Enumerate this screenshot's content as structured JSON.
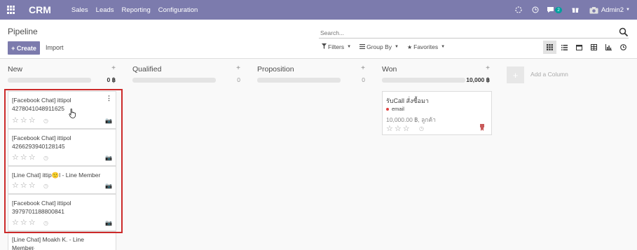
{
  "navbar": {
    "brand": "CRM",
    "menu": [
      "Sales",
      "Leads",
      "Reporting",
      "Configuration"
    ],
    "messages_count": "2",
    "user": "Admin2",
    "bg_color": "#7c7bad"
  },
  "control": {
    "title": "Pipeline",
    "create_label": "+ Create",
    "import_label": "Import",
    "search_placeholder": "Search...",
    "filters_label": "Filters",
    "groupby_label": "Group By",
    "favorites_label": "Favorites"
  },
  "columns": [
    {
      "title": "New",
      "sum": "0 ฿"
    },
    {
      "title": "Qualified",
      "sum": "0"
    },
    {
      "title": "Proposition",
      "sum": "0"
    },
    {
      "title": "Won",
      "sum": "10,000 ฿"
    }
  ],
  "add_column_label": "Add a Column",
  "new_cards": [
    {
      "title": "[Facebook Chat] ittipol 4278041048911625"
    },
    {
      "title": "[Facebook Chat] ittipol 4266293940128145"
    },
    {
      "title": "[Line Chat] ittip🙂l - Line Member"
    },
    {
      "title": "[Facebook Chat] ittipol 3979701188800841"
    },
    {
      "title": "[Line Chat] Moakh K. - Line Member"
    }
  ],
  "won_card": {
    "title": "รับCall สั่งซื้อมา",
    "tag": "email",
    "revenue": "10,000.00 ฿, ลูกค้า"
  },
  "colors": {
    "accent": "#7c7bad",
    "highlight": "#cc2a2a",
    "tag_dot": "#e04040",
    "badge": "#00a09d"
  }
}
